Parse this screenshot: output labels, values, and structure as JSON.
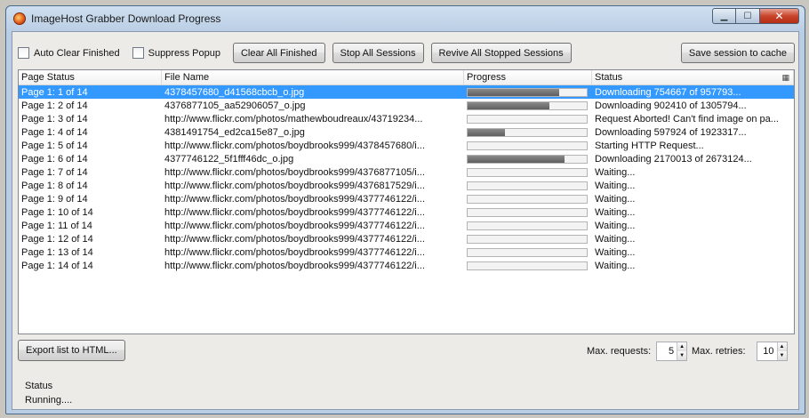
{
  "window": {
    "title": "ImageHost Grabber Download Progress"
  },
  "toolbar": {
    "auto_clear_label": "Auto Clear Finished",
    "suppress_popup_label": "Suppress Popup",
    "clear_all_label": "Clear All Finished",
    "stop_all_label": "Stop All Sessions",
    "revive_all_label": "Revive All Stopped Sessions",
    "save_session_label": "Save session to cache"
  },
  "grid": {
    "columns": [
      "Page Status",
      "File Name",
      "Progress",
      "Status"
    ],
    "rows": [
      {
        "page": "Page 1: 1 of 14",
        "file": "4378457680_d41568cbcb_o.jpg",
        "progress": 0.77,
        "status": "Downloading 754667 of 957793..."
      },
      {
        "page": "Page 1: 2 of 14",
        "file": "4376877105_aa52906057_o.jpg",
        "progress": 0.69,
        "status": "Downloading 902410 of 1305794..."
      },
      {
        "page": "Page 1: 3 of 14",
        "file": "http://www.flickr.com/photos/mathewboudreaux/43719234...",
        "progress": 0,
        "status": "Request Aborted!  Can't find image on pa..."
      },
      {
        "page": "Page 1: 4 of 14",
        "file": "4381491754_ed2ca15e87_o.jpg",
        "progress": 0.31,
        "status": "Downloading 597924 of 1923317..."
      },
      {
        "page": "Page 1: 5 of 14",
        "file": "http://www.flickr.com/photos/boydbrooks999/4378457680/i...",
        "progress": 0,
        "status": "Starting HTTP Request..."
      },
      {
        "page": "Page 1: 6 of 14",
        "file": "4377746122_5f1fff46dc_o.jpg",
        "progress": 0.81,
        "status": "Downloading 2170013 of 2673124..."
      },
      {
        "page": "Page 1: 7 of 14",
        "file": "http://www.flickr.com/photos/boydbrooks999/4376877105/i...",
        "progress": 0,
        "status": "Waiting..."
      },
      {
        "page": "Page 1: 8 of 14",
        "file": "http://www.flickr.com/photos/boydbrooks999/4376817529/i...",
        "progress": 0,
        "status": "Waiting..."
      },
      {
        "page": "Page 1: 9 of 14",
        "file": "http://www.flickr.com/photos/boydbrooks999/4377746122/i...",
        "progress": 0,
        "status": "Waiting..."
      },
      {
        "page": "Page 1: 10 of 14",
        "file": "http://www.flickr.com/photos/boydbrooks999/4377746122/i...",
        "progress": 0,
        "status": "Waiting..."
      },
      {
        "page": "Page 1: 11 of 14",
        "file": "http://www.flickr.com/photos/boydbrooks999/4377746122/i...",
        "progress": 0,
        "status": "Waiting..."
      },
      {
        "page": "Page 1: 12 of 14",
        "file": "http://www.flickr.com/photos/boydbrooks999/4377746122/i...",
        "progress": 0,
        "status": "Waiting..."
      },
      {
        "page": "Page 1: 13 of 14",
        "file": "http://www.flickr.com/photos/boydbrooks999/4377746122/i...",
        "progress": 0,
        "status": "Waiting..."
      },
      {
        "page": "Page 1: 14 of 14",
        "file": "http://www.flickr.com/photos/boydbrooks999/4377746122/i...",
        "progress": 0,
        "status": "Waiting..."
      }
    ],
    "selected_index": 0
  },
  "bottom": {
    "export_label": "Export list to HTML...",
    "max_requests_label": "Max. requests:",
    "max_requests_value": "5",
    "max_retries_label": "Max. retries:",
    "max_retries_value": "10"
  },
  "status": {
    "heading": "Status",
    "value": "Running...."
  },
  "colors": {
    "selection": "#3399ff",
    "progress_fill": "#6b6b6b"
  }
}
